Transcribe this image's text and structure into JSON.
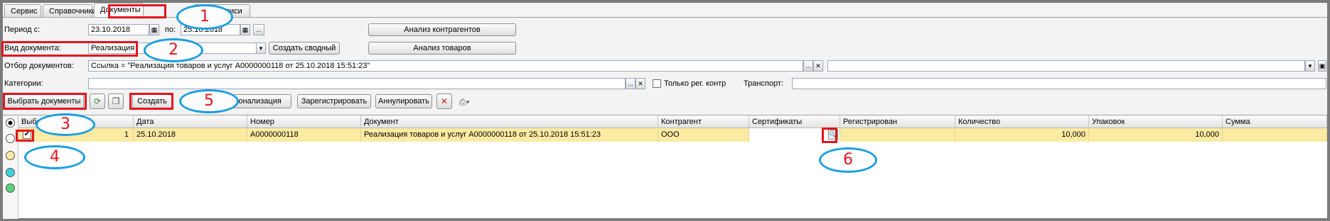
{
  "tabs": [
    {
      "label": "Сервис"
    },
    {
      "label": "Справочники"
    },
    {
      "label": "Документы"
    },
    {
      "label": "писи"
    }
  ],
  "filters": {
    "period_from_label": "Период с:",
    "period_from": "23.10.2018",
    "period_to_label": "по:",
    "period_to": "25.10.2018",
    "doc_type_label": "Вид документа:",
    "doc_type_value": "Реализация",
    "doc_filter_label": "Отбор документов:",
    "doc_filter_value": "Ссылка = \"Реализация товаров и услуг А0000000118 от 25.10.2018 15:51:23\"",
    "categories_label": "Категории:",
    "only_reg_label": "Только рег. контр",
    "transport_label": "Транспорт:"
  },
  "buttons": {
    "dots": "...",
    "create_summary": "Создать сводный",
    "analysis_contractors": "Анализ контрагентов",
    "analysis_goods": "Анализ товаров",
    "select_documents": "Выбрать документы",
    "create": "Создать",
    "rationalization": "тионализация",
    "register": "Зарегистрировать",
    "annul": "Аннулировать"
  },
  "table": {
    "headers": [
      "Выбр",
      "Дата",
      "Номер",
      "Документ",
      "Контрагент",
      "Сертификаты",
      "Регистрирован",
      "Количество",
      "Упаковок",
      "Сумма"
    ],
    "rows": [
      {
        "num": "1",
        "date": "25.10.2018",
        "number": "А0000000118",
        "document": "Реализация товаров и услуг А0000000118 от 25.10.2018 15:51:23",
        "contractor": "ООО",
        "certificates": "",
        "registered": "",
        "quantity": "10,000",
        "packages": "10,000",
        "sum": ""
      }
    ]
  },
  "annotations": [
    "1",
    "2",
    "3",
    "4",
    "5",
    "6"
  ],
  "colors": {
    "accent_red": "#e3141e",
    "annotation_blue": "#1b9ee0",
    "row_highlight": "#fbeaa2"
  }
}
